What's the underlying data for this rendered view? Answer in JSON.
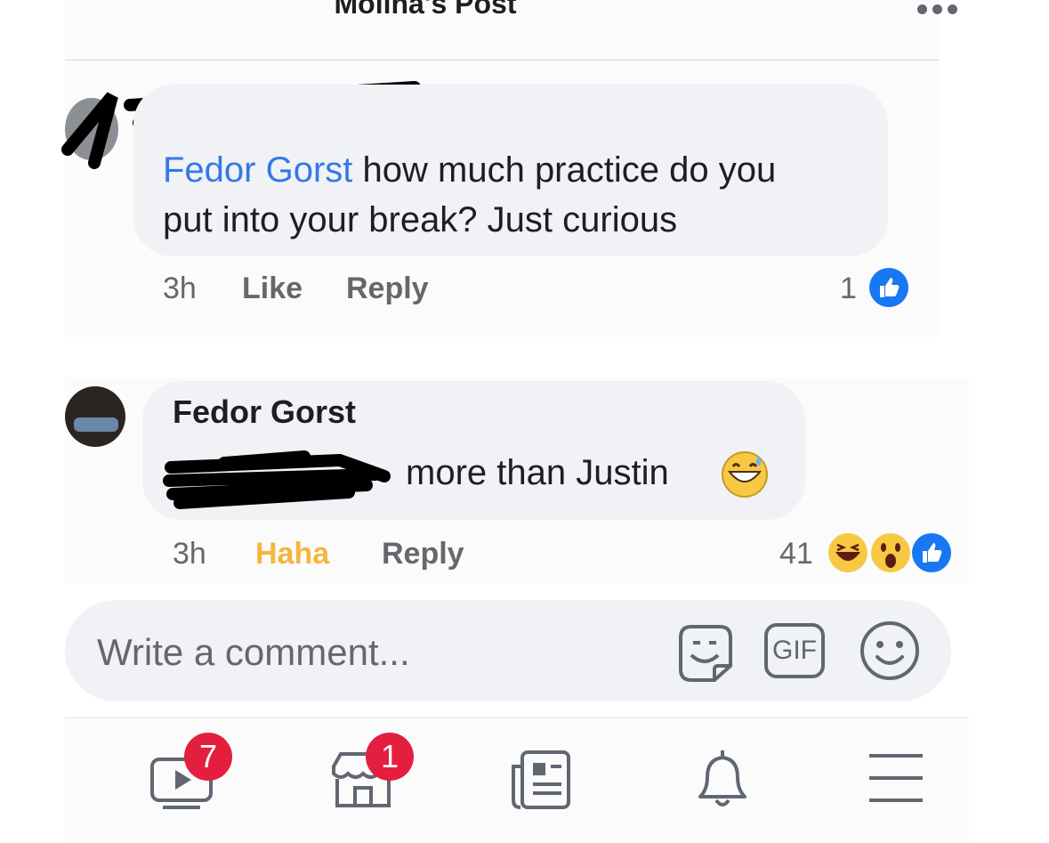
{
  "header": {
    "title": "Molina's Post"
  },
  "comments": [
    {
      "author": "",
      "mention": "Fedor Gorst",
      "text_line1": " how much practice do you",
      "text_line2": "put into your break?   Just curious",
      "time": "3h",
      "like_label": "Like",
      "reply_label": "Reply",
      "reaction_count": "1"
    },
    {
      "author": "Fedor Gorst",
      "text": "more than Justin",
      "time": "3h",
      "reaction_label": "Haha",
      "reply_label": "Reply",
      "reaction_count": "41"
    }
  ],
  "composer": {
    "placeholder": "Write a comment...",
    "gif_label": "GIF"
  },
  "tabbar": {
    "watch_badge": "7",
    "marketplace_badge": "1"
  },
  "colors": {
    "mention": "#3578e5",
    "haha": "#f5b53d",
    "like_blue": "#1877f2",
    "badge": "#e41e3f"
  }
}
